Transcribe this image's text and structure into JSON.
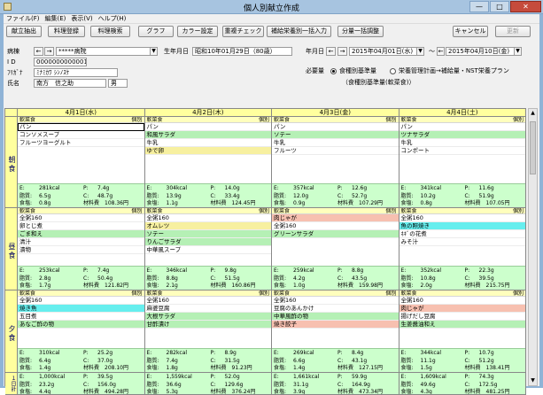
{
  "window": {
    "title": "個人別献立作成",
    "minimize": "—",
    "maximize": "□",
    "close": "✕"
  },
  "menu": [
    "ファイル(F)",
    "編集(E)",
    "表示(V)",
    "ヘルプ(H)"
  ],
  "toolbar": {
    "buttons": [
      "献立抽出",
      "料理登録",
      "料理検索",
      "グラフ",
      "カラー設定",
      "重複チェック",
      "補給栄養別一括入力",
      "分量一括調整"
    ],
    "cancel": "キャンセル",
    "update": "更新"
  },
  "patient": {
    "ward_label": "病棟",
    "ward_value": "*****病院",
    "id_label": "I D",
    "id_value": "0000000000001",
    "kana_label": "ﾌﾘｶﾞﾅ",
    "kana_value": "ﾐﾅﾐｶﾜ ｼﾝﾉｽｹ",
    "name_label": "氏名",
    "name_value": "南方　信之助",
    "sex_value": "男",
    "birth_label": "生年月日",
    "birth_value": "昭和10年01月29日（80歳）"
  },
  "period": {
    "label": "年月日",
    "from": "2015年04月01日(水)",
    "tilde": "〜",
    "to": "2015年04月10日(金)"
  },
  "required": {
    "label": "必要量",
    "opt1": "食種別基準量",
    "opt2": "栄養管理計画→補給量・NST栄養プラン",
    "note": "（食種別基準量(軟菜食)）"
  },
  "meals": [
    "朝食",
    "昼食",
    "夕食"
  ],
  "daily_total_label": "１日計",
  "nutrient_labels": {
    "e": "E:",
    "p": "P:",
    "fat": "脂質:",
    "c": "C:",
    "salt": "食塩:",
    "cost": "材料費"
  },
  "days": [
    {
      "date": "4月1日(水)",
      "meals": [
        {
          "type": "軟菜食",
          "div": "個別",
          "items": [
            {
              "t": "パン",
              "c": ""
            },
            {
              "t": "コンソメスープ",
              "c": ""
            },
            {
              "t": "フルーツヨーグルト",
              "c": ""
            }
          ],
          "n": {
            "e": "281kcal",
            "p": "7.4g",
            "fat": "6.5g",
            "c": "48.7g",
            "salt": "0.8g",
            "cost": "108.36円"
          }
        },
        {
          "type": "軟菜食",
          "div": "個別",
          "items": [
            {
              "t": "全粥160",
              "c": ""
            },
            {
              "t": "卵とじ煮",
              "c": ""
            },
            {
              "t": "ごま和え",
              "c": "#b5f0b5"
            },
            {
              "t": "清汁",
              "c": ""
            },
            {
              "t": "漬物",
              "c": ""
            }
          ],
          "n": {
            "e": "253kcal",
            "p": "7.4g",
            "fat": "2.8g",
            "c": "50.4g",
            "salt": "1.7g",
            "cost": "121.82円"
          }
        },
        {
          "type": "軟菜食",
          "div": "個別",
          "items": [
            {
              "t": "全粥160",
              "c": ""
            },
            {
              "t": "焼き魚",
              "c": "#66eeee"
            },
            {
              "t": "五目煮",
              "c": ""
            },
            {
              "t": "あなご酢の物",
              "c": "#b5f0b5"
            }
          ],
          "n": {
            "e": "310kcal",
            "p": "25.2g",
            "fat": "6.4g",
            "c": "37.0g",
            "salt": "1.4g",
            "cost": "208.10円"
          }
        }
      ],
      "total": {
        "e": "1,000kcal",
        "p": "39.5g",
        "fat": "23.2g",
        "c": "156.0g",
        "salt": "4.4g",
        "cost": "494.28円"
      }
    },
    {
      "date": "4月2日(木)",
      "meals": [
        {
          "type": "軟菜食",
          "div": "個別",
          "items": [
            {
              "t": "パン",
              "c": ""
            },
            {
              "t": "和風サラダ",
              "c": "#b5f0b5"
            },
            {
              "t": "牛乳",
              "c": ""
            },
            {
              "t": "ゆで卵",
              "c": "#f7f0a0"
            }
          ],
          "n": {
            "e": "304kcal",
            "p": "14.0g",
            "fat": "13.9g",
            "c": "33.4g",
            "salt": "1.1g",
            "cost": "124.45円"
          }
        },
        {
          "type": "軟菜食",
          "div": "個別",
          "items": [
            {
              "t": "全粥160",
              "c": ""
            },
            {
              "t": "オムレツ",
              "c": "#f7f0a0"
            },
            {
              "t": "ソテー",
              "c": "#b5f0b5"
            },
            {
              "t": "りんごサラダ",
              "c": "#b5f0b5"
            },
            {
              "t": "中華風スープ",
              "c": ""
            }
          ],
          "n": {
            "e": "346kcal",
            "p": "9.8g",
            "fat": "8.8g",
            "c": "51.5g",
            "salt": "2.1g",
            "cost": "160.86円"
          }
        },
        {
          "type": "軟菜食",
          "div": "個別",
          "items": [
            {
              "t": "全粥160",
              "c": ""
            },
            {
              "t": "麻婆豆腐",
              "c": ""
            },
            {
              "t": "大根サラダ",
              "c": "#b5f0b5"
            },
            {
              "t": "甘酢漬け",
              "c": "#b5f0b5"
            }
          ],
          "n": {
            "e": "282kcal",
            "p": "8.9g",
            "fat": "7.4g",
            "c": "31.5g",
            "salt": "1.8g",
            "cost": "91.23円"
          }
        }
      ],
      "total": {
        "e": "1,559kcal",
        "p": "52.0g",
        "fat": "36.6g",
        "c": "129.6g",
        "salt": "5.3g",
        "cost": "376.24円"
      }
    },
    {
      "date": "4月3日(金)",
      "meals": [
        {
          "type": "軟菜食",
          "div": "個別",
          "items": [
            {
              "t": "パン",
              "c": ""
            },
            {
              "t": "ソテー",
              "c": "#b5f0b5"
            },
            {
              "t": "牛乳",
              "c": ""
            },
            {
              "t": "フルーツ",
              "c": ""
            }
          ],
          "n": {
            "e": "357kcal",
            "p": "12.6g",
            "fat": "12.0g",
            "c": "52.7g",
            "salt": "0.9g",
            "cost": "107.29円"
          }
        },
        {
          "type": "軟菜食",
          "div": "個別",
          "items": [
            {
              "t": "肉じゃが",
              "c": "#f7c0b0"
            },
            {
              "t": "全粥160",
              "c": ""
            },
            {
              "t": "グリーンサラダ",
              "c": "#b5f0b5"
            }
          ],
          "n": {
            "e": "259kcal",
            "p": "8.8g",
            "fat": "4.2g",
            "c": "43.5g",
            "salt": "1.0g",
            "cost": "159.98円"
          }
        },
        {
          "type": "軟菜食",
          "div": "個別",
          "items": [
            {
              "t": "全粥160",
              "c": ""
            },
            {
              "t": "豆腐のあんかけ",
              "c": ""
            },
            {
              "t": "中華風酢の物",
              "c": "#b5f0b5"
            },
            {
              "t": "焼き餃子",
              "c": "#f7c0b0"
            }
          ],
          "n": {
            "e": "269kcal",
            "p": "8.4g",
            "fat": "6.6g",
            "c": "43.1g",
            "salt": "1.4g",
            "cost": "127.15円"
          }
        }
      ],
      "total": {
        "e": "1,661kcal",
        "p": "59.9g",
        "fat": "31.1g",
        "c": "164.9g",
        "salt": "3.9g",
        "cost": "473.34円"
      }
    },
    {
      "date": "4月4日(土)",
      "meals": [
        {
          "type": "軟菜食",
          "div": "個別",
          "items": [
            {
              "t": "パン",
              "c": ""
            },
            {
              "t": "ツナサラダ",
              "c": "#b5f0b5"
            },
            {
              "t": "牛乳",
              "c": ""
            },
            {
              "t": "コンポート",
              "c": ""
            }
          ],
          "n": {
            "e": "341kcal",
            "p": "11.6g",
            "fat": "10.2g",
            "c": "51.9g",
            "salt": "0.8g",
            "cost": "107.05円"
          }
        },
        {
          "type": "軟菜食",
          "div": "個別",
          "items": [
            {
              "t": "全粥160",
              "c": ""
            },
            {
              "t": "魚の照焼き",
              "c": "#66eeee"
            },
            {
              "t": "ﾈｷﾞの花煮",
              "c": ""
            },
            {
              "t": "みそ汁",
              "c": ""
            }
          ],
          "n": {
            "e": "352kcal",
            "p": "22.3g",
            "fat": "10.8g",
            "c": "39.5g",
            "salt": "2.0g",
            "cost": "215.75円"
          }
        },
        {
          "type": "軟菜食",
          "div": "個別",
          "items": [
            {
              "t": "全粥160",
              "c": ""
            },
            {
              "t": "肉じゃが",
              "c": "#f7c0b0"
            },
            {
              "t": "揚げだし豆腐",
              "c": ""
            },
            {
              "t": "生姜醤油和え",
              "c": "#b5f0b5"
            }
          ],
          "n": {
            "e": "344kcal",
            "p": "10.7g",
            "fat": "11.1g",
            "c": "51.2g",
            "salt": "1.5g",
            "cost": "138.41円"
          }
        }
      ],
      "total": {
        "e": "1,609kcal",
        "p": "74.3g",
        "fat": "49.6g",
        "c": "172.5g",
        "salt": "4.3g",
        "cost": "481.25円"
      }
    }
  ]
}
